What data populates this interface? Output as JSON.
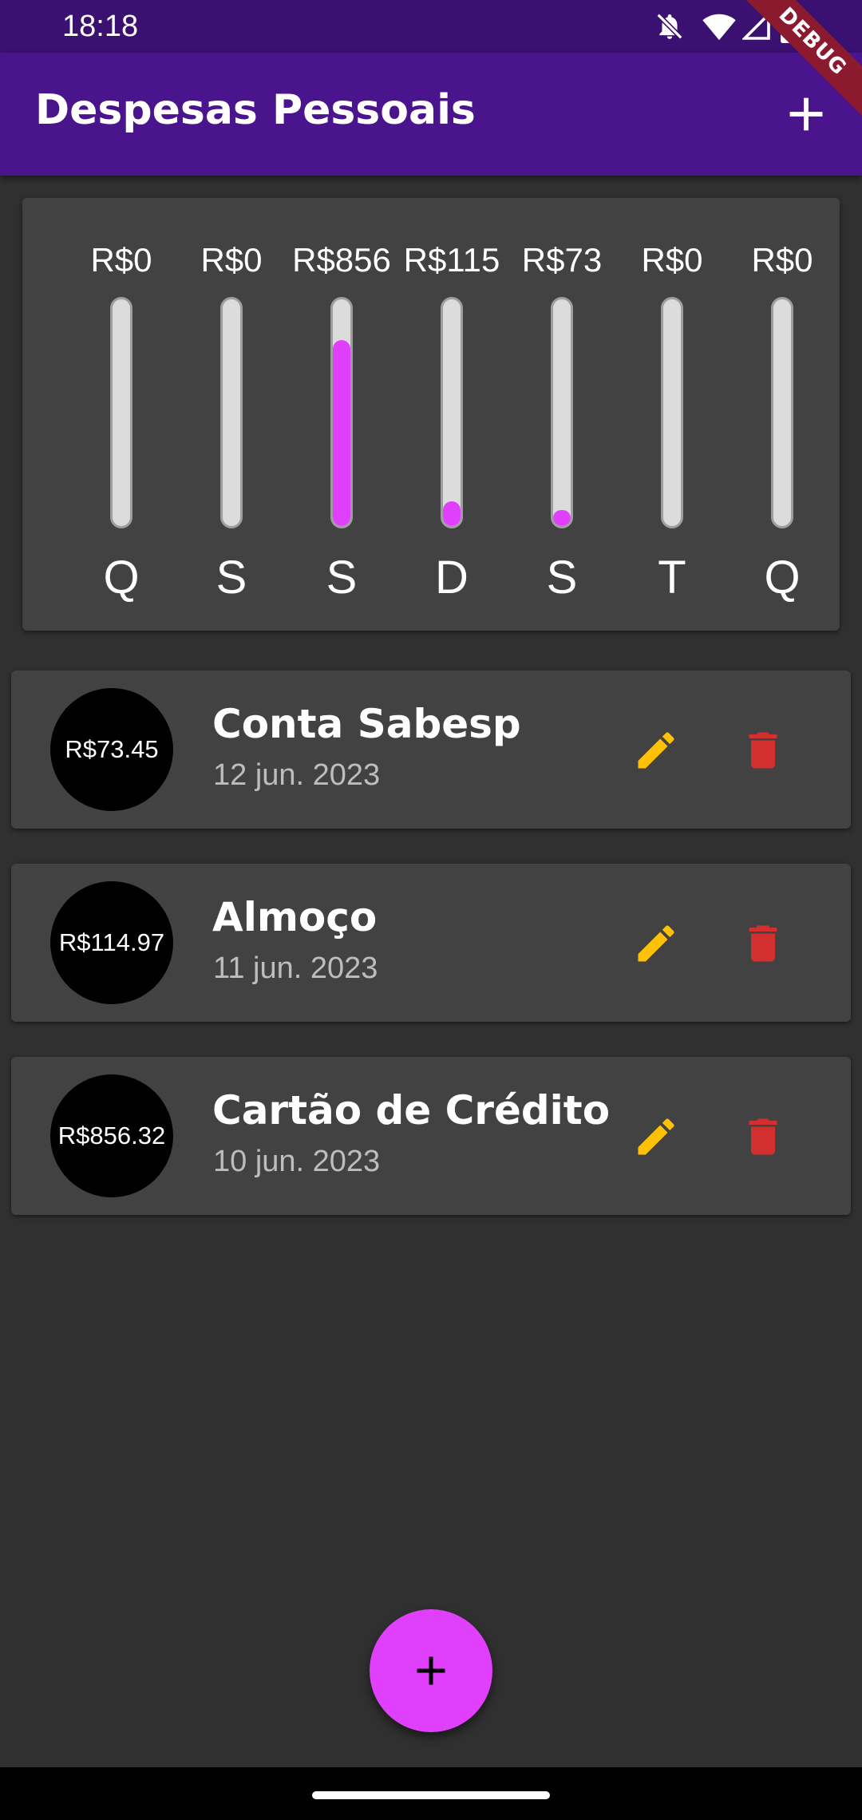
{
  "status_bar": {
    "time": "18:18"
  },
  "app_bar": {
    "title": "Despesas Pessoais",
    "debug_label": "DEBUG"
  },
  "colors": {
    "app_bar": "#4a148c",
    "status_bar": "#3a1170",
    "accent": "#e040fb",
    "edit_icon": "#ffc107",
    "delete_icon": "#d32f2f",
    "background": "#303030",
    "card": "#424242"
  },
  "chart_data": {
    "type": "bar",
    "categories": [
      "Q",
      "S",
      "S",
      "D",
      "S",
      "T",
      "Q"
    ],
    "value_labels": [
      "R$0",
      "R$0",
      "R$856",
      "R$115",
      "R$73",
      "R$0",
      "R$0"
    ],
    "fill_fractions": [
      0,
      0,
      0.82,
      0.11,
      0.07,
      0,
      0
    ]
  },
  "transactions": [
    {
      "amount": "R$73.45",
      "title": "Conta Sabesp",
      "date": "12 jun. 2023"
    },
    {
      "amount": "R$114.97",
      "title": "Almoço",
      "date": "11 jun. 2023"
    },
    {
      "amount": "R$856.32",
      "title": "Cartão de Crédito",
      "date": "10 jun. 2023"
    }
  ],
  "icons": {
    "app_bar_action": "add-icon",
    "edit": "pencil-icon",
    "delete": "trash-icon",
    "fab": "add-icon"
  }
}
